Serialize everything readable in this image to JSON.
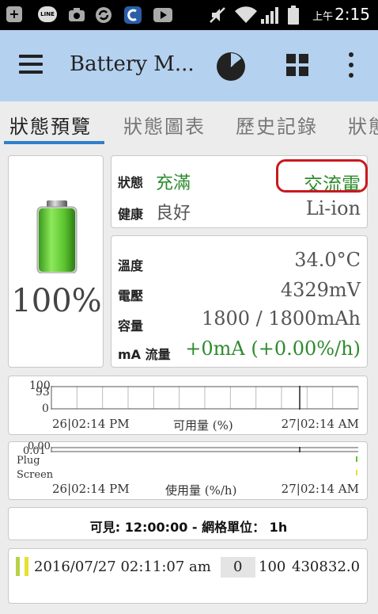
{
  "status_bar": {
    "icons": [
      "plus-box-icon",
      "line-app-icon",
      "camera-icon",
      "sync-icon",
      "c-app-icon",
      "youtube-icon",
      "mute-icon",
      "wifi-icon",
      "signal-icon",
      "battery-status-icon"
    ],
    "line_label": "LINE",
    "ampm": "上午",
    "time": "2:15"
  },
  "app_bar": {
    "title": "Battery M...",
    "icons": [
      "menu-icon",
      "pie-chart-icon",
      "grid-icon",
      "more-vert-icon"
    ]
  },
  "tabs": [
    {
      "label": "狀態預覽",
      "active": true
    },
    {
      "label": "狀態圖表",
      "active": false
    },
    {
      "label": "歷史記錄",
      "active": false
    },
    {
      "label": "狀態",
      "active": false
    }
  ],
  "battery": {
    "percent_text": "100%",
    "level": 1.0,
    "fill_color": "#5cc431"
  },
  "status": {
    "state_label": "狀態",
    "state_value": "充滿",
    "power_source": "交流電",
    "health_label": "健康",
    "health_value": "良好",
    "technology": "Li-ion"
  },
  "readings": {
    "temperature_label": "溫度",
    "temperature_value": "34.0°C",
    "voltage_label": "電壓",
    "voltage_value": "4329mV",
    "capacity_label": "容量",
    "capacity_value": "1800 / 1800mAh",
    "current_label": "mA 流量",
    "current_value": "+0mA (+0.00%/h)"
  },
  "chart1": {
    "y_ticks": [
      "100",
      "93",
      "0"
    ],
    "start_label": "26|02:14 PM",
    "center_label": "可用量 (%)",
    "end_label": "27|02:14 AM"
  },
  "chart2": {
    "y_ticks": [
      "0.00",
      "0.01"
    ],
    "row_labels": [
      "Plug",
      "Screen"
    ],
    "start_label": "26|02:14 PM",
    "center_label": "使用量 (%/h)",
    "end_label": "27|02:14 AM"
  },
  "scale": {
    "text": "可見: 12:00:00 - 網格單位： 1h"
  },
  "log": {
    "datetime": "2016/07/27  02:11:07 am",
    "current": "0",
    "level": "100",
    "voltage": "4308",
    "temperature": "32.0"
  },
  "colors": {
    "app_bar_bg": "#b4d1ef",
    "tab_indicator": "#2f80c8",
    "green_value": "#2e8b2e",
    "highlight_ring": "#c9191e"
  }
}
